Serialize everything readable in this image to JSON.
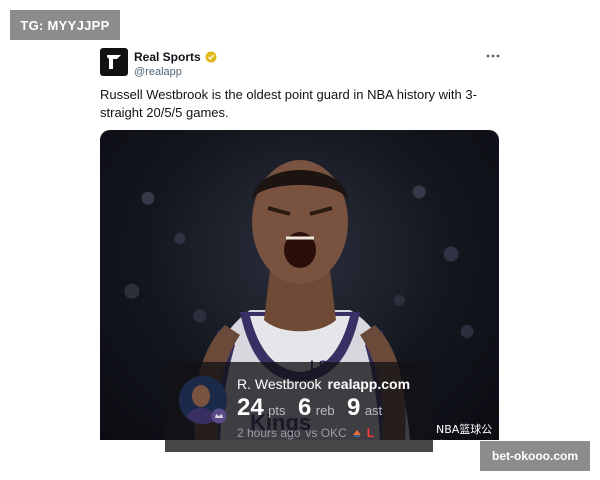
{
  "watermarks": {
    "top_left": "TG: MYYJJPP",
    "bottom_right": "bet-okooo.com",
    "image_corner": "NBA篮球公寓"
  },
  "tweet": {
    "author_name": "Real Sports",
    "author_handle": "@realapp",
    "verified": true,
    "more_icon": "more-horizontal-icon",
    "text": "Russell Westbrook is the oldest point guard in NBA history with 3-straight 20/5/5 games."
  },
  "stat_card": {
    "player": "R. Westbrook",
    "brand": "realapp.com",
    "points": "24",
    "points_unit": "pts",
    "rebounds": "6",
    "rebounds_unit": "reb",
    "assists": "9",
    "assists_unit": "ast",
    "time": "2 hours ago",
    "opponent": "vs OKC",
    "result": "L"
  },
  "colors": {
    "badge_bg": "#8c8c8c",
    "handle_gray": "#536471",
    "verified_gold": "#e2b719",
    "loss_red": "#ff3b30",
    "jersey_purple": "#3a2f63"
  }
}
